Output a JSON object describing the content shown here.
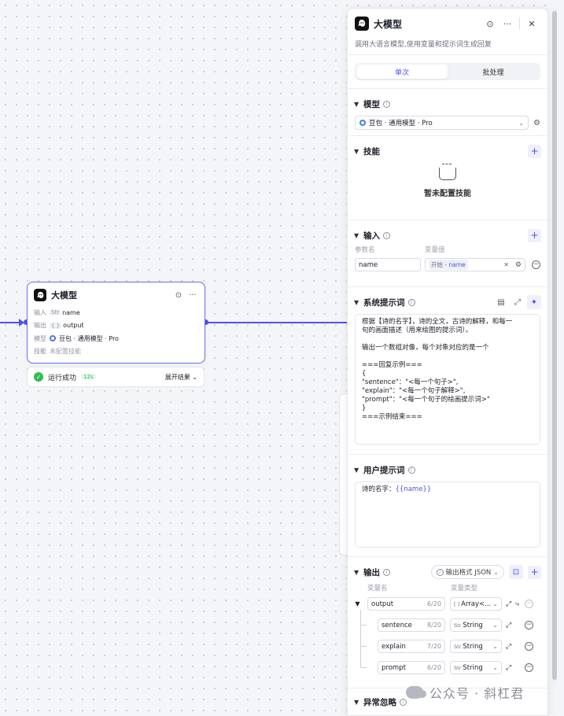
{
  "canvas_node": {
    "title": "大模型",
    "rows": {
      "input_label": "输入",
      "input_type": "Str",
      "input_value": "name",
      "output_label": "输出",
      "output_type": "{ }",
      "output_value": "output",
      "model_label": "模型",
      "model_value": "豆包 · 通用模型 · Pro",
      "skill_label": "技能",
      "skill_value": "未配置技能"
    }
  },
  "run_status": {
    "text": "运行成功",
    "time": "12s",
    "expand_label": "展开结果"
  },
  "panel": {
    "title": "大模型",
    "description": "调用大语言模型,使用变量和提示词生成回复",
    "tabs": [
      {
        "label": "单次"
      },
      {
        "label": "批处理"
      }
    ],
    "model": {
      "title": "模型",
      "selected": "豆包 · 通用模型 · Pro"
    },
    "skills": {
      "title": "技能",
      "empty_text": "暂未配置技能"
    },
    "input": {
      "title": "输入",
      "col_name": "参数名",
      "col_value": "变量值",
      "name_value": "name",
      "ref_source": "开始 -",
      "ref_var": "name"
    },
    "system_prompt": {
      "title": "系统提示词",
      "lines": [
        "根据【诗的名字】，诗的全文，古诗的解释，和每一",
        "句的画面描述（用来绘图的提示词）。",
        "",
        "输出一个数组对像，每个对象对应的是一个",
        "",
        "===回复示例===",
        "{",
        "\"sentence\"：\"<每一个句子>\",",
        "\"explain\"：\"<每一个句子解释>\",",
        "\"prompt\"：\"<每一个句子的绘画提示词>\"",
        "}",
        "===示例结束==="
      ]
    },
    "user_prompt": {
      "title": "用户提示词",
      "prefix": "诗的名字：",
      "variable": "{{name}}"
    },
    "output": {
      "title": "输出",
      "format_label": "输出格式 JSON",
      "col_name": "变量名",
      "col_type": "变量类型",
      "fields": [
        {
          "name": "output",
          "count": "6/20",
          "type_icon": "[ ]",
          "type": "Array<..."
        },
        {
          "name": "sentence",
          "count": "8/20",
          "type_icon": "Str",
          "type": "String"
        },
        {
          "name": "explain",
          "count": "7/20",
          "type_icon": "Str",
          "type": "String"
        },
        {
          "name": "prompt",
          "count": "6/20",
          "type_icon": "Str",
          "type": "String"
        }
      ]
    },
    "exception": {
      "title": "异常忽略"
    }
  },
  "watermark": {
    "text": "公众号 · 斜杠君"
  },
  "icons": {
    "node_logo": "llm-logo-icon",
    "run": "play-icon",
    "more": "more-icon",
    "close": "close-icon",
    "info": "info-icon",
    "add": "plus-icon",
    "gear": "gear-icon",
    "chevron": "chevron-down-icon"
  },
  "colors": {
    "accent": "#4d53e8",
    "success": "#2dbe4e",
    "panel_bg": "#ffffff",
    "canvas_bg": "#f4f5f8"
  }
}
